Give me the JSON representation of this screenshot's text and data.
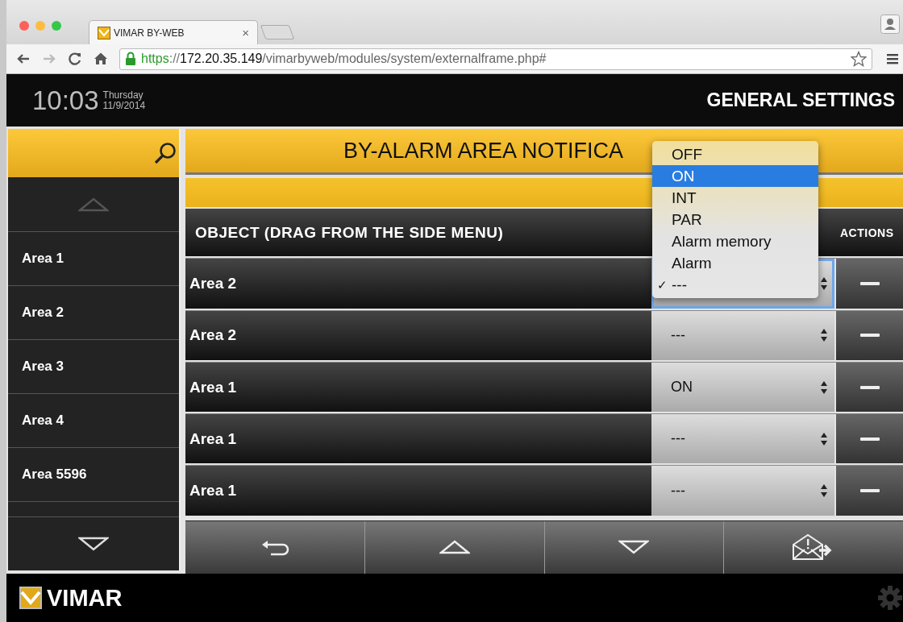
{
  "browser": {
    "tab": {
      "title": "VIMAR BY-WEB",
      "close": "×"
    },
    "url": {
      "scheme": "https",
      "separator": "://",
      "host": "172.20.35.149",
      "path": "/vimarbyweb/modules/system/externalframe.php#"
    },
    "forward_disabled": true
  },
  "header": {
    "time": "10:03",
    "weekday": "Thursday",
    "date": "11/9/2014",
    "title": "GENERAL SETTINGS"
  },
  "sidebar": {
    "items": [
      {
        "label": "Area 1"
      },
      {
        "label": "Area 2"
      },
      {
        "label": "Area 3"
      },
      {
        "label": "Area 4"
      },
      {
        "label": "Area 5596"
      }
    ]
  },
  "panel": {
    "title": "BY-ALARM AREA NOTIFICA",
    "columns": [
      "OBJECT (DRAG FROM THE SIDE MENU)",
      "ACTIONS"
    ],
    "rows": [
      {
        "object": "Area 2",
        "focused": true
      },
      {
        "object": "Area 2",
        "value": "---",
        "focused": false
      },
      {
        "object": "Area 1",
        "value": "ON",
        "focused": false
      },
      {
        "object": "Area 1",
        "value": "---",
        "focused": false
      },
      {
        "object": "Area 1",
        "value": "---",
        "focused": false
      }
    ]
  },
  "dropdown": {
    "options": [
      {
        "label": "OFF",
        "selected": false,
        "checked": false
      },
      {
        "label": "ON",
        "selected": true,
        "checked": false
      },
      {
        "label": "INT",
        "selected": false,
        "checked": false
      },
      {
        "label": "PAR",
        "selected": false,
        "checked": false
      },
      {
        "label": "Alarm memory",
        "selected": false,
        "checked": false
      },
      {
        "label": "Alarm",
        "selected": false,
        "checked": false
      },
      {
        "label": "---",
        "selected": false,
        "checked": true
      }
    ],
    "check": "✓"
  },
  "footer": {
    "brand": "VIMAR"
  }
}
